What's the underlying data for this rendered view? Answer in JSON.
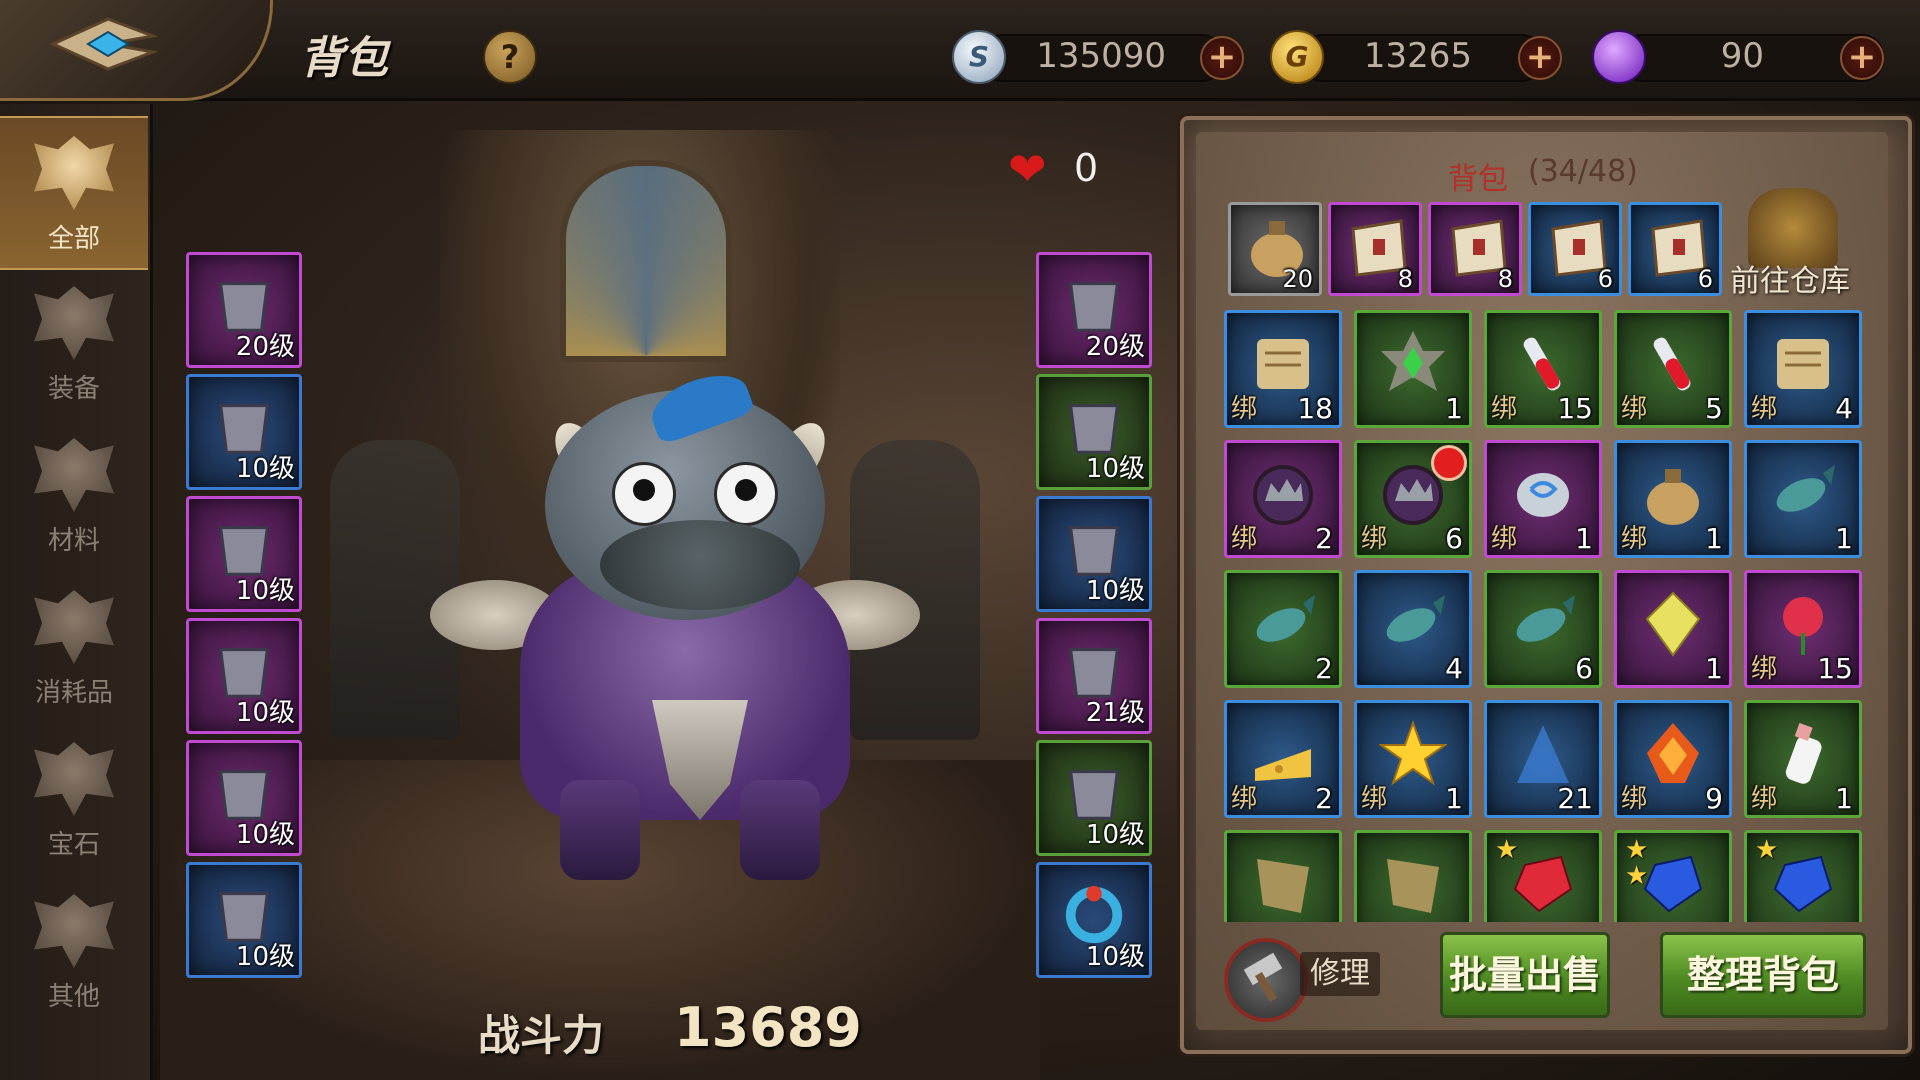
{
  "header": {
    "title": "背包",
    "help_icon": "?",
    "currencies": [
      {
        "name": "silver-coin-icon",
        "symbol": "S",
        "value": "135090",
        "color": "#c8d4e0"
      },
      {
        "name": "gold-coin-icon",
        "symbol": "G",
        "value": "13265",
        "color": "#e8b428"
      },
      {
        "name": "purple-gem-icon",
        "symbol": "",
        "value": "90",
        "color": "#9a48e0"
      }
    ],
    "plus": "+"
  },
  "tabs": [
    {
      "label": "全部",
      "active": true
    },
    {
      "label": "装备",
      "active": false
    },
    {
      "label": "材料",
      "active": false
    },
    {
      "label": "消耗品",
      "active": false
    },
    {
      "label": "宝石",
      "active": false
    },
    {
      "label": "其他",
      "active": false
    }
  ],
  "character": {
    "likes": "0",
    "power_label": "战斗力",
    "power_value": "13689"
  },
  "equipment_left": [
    {
      "level": "20级",
      "quality": "purple",
      "icon": "horn-weapon-icon"
    },
    {
      "level": "10级",
      "quality": "blue",
      "icon": "spiked-pauldron-icon"
    },
    {
      "level": "10级",
      "quality": "purple",
      "icon": "flame-horn-icon"
    },
    {
      "level": "10级",
      "quality": "purple",
      "icon": "belt-icon"
    },
    {
      "level": "10级",
      "quality": "purple",
      "icon": "armor-pants-icon"
    },
    {
      "level": "10级",
      "quality": "blue",
      "icon": "boots-icon"
    }
  ],
  "equipment_right": [
    {
      "level": "20级",
      "quality": "purple",
      "icon": "helmet-icon"
    },
    {
      "level": "10级",
      "quality": "green",
      "icon": "amulet-icon"
    },
    {
      "level": "10级",
      "quality": "blue",
      "icon": "chest-armor-icon"
    },
    {
      "level": "21级",
      "quality": "purple",
      "icon": "gold-bracer-icon"
    },
    {
      "level": "10级",
      "quality": "green",
      "icon": "gauntlet-icon"
    },
    {
      "level": "10级",
      "quality": "blue",
      "icon": "ring-icon"
    }
  ],
  "inventory": {
    "title": "背包",
    "count": "(34/48)",
    "bind_label": "绑",
    "top_row": [
      {
        "count": "20",
        "quality": "gray",
        "icon": "money-bag-icon"
      },
      {
        "count": "8",
        "quality": "purple",
        "icon": "bag-icon"
      },
      {
        "count": "8",
        "quality": "purple",
        "icon": "bag-icon"
      },
      {
        "count": "6",
        "quality": "blue",
        "icon": "bag-icon"
      },
      {
        "count": "6",
        "quality": "blue",
        "icon": "bag-icon"
      }
    ],
    "warehouse_label": "前往仓库",
    "rows": [
      [
        {
          "count": "18",
          "bound": true,
          "quality": "blue",
          "icon": "horn-scroll-icon"
        },
        {
          "count": "1",
          "bound": false,
          "quality": "green",
          "icon": "green-crystal-badge-icon"
        },
        {
          "count": "15",
          "bound": true,
          "quality": "green",
          "icon": "red-potion-icon"
        },
        {
          "count": "5",
          "bound": true,
          "quality": "green",
          "icon": "red-potion-icon"
        },
        {
          "count": "4",
          "bound": true,
          "quality": "blue",
          "icon": "scroll-icon"
        }
      ],
      [
        {
          "count": "2",
          "bound": true,
          "quality": "purple",
          "icon": "crown-orb-icon"
        },
        {
          "count": "6",
          "bound": true,
          "quality": "green",
          "icon": "crown-orb-icon",
          "dot": true
        },
        {
          "count": "1",
          "bound": true,
          "quality": "purple",
          "icon": "rune-stone-icon"
        },
        {
          "count": "1",
          "bound": true,
          "quality": "blue",
          "icon": "gem-pouch-icon"
        },
        {
          "count": "1",
          "bound": false,
          "quality": "blue",
          "icon": "purple-fish-icon"
        }
      ],
      [
        {
          "count": "2",
          "bound": false,
          "quality": "green",
          "icon": "fish-icon"
        },
        {
          "count": "4",
          "bound": false,
          "quality": "blue",
          "icon": "fish-icon"
        },
        {
          "count": "6",
          "bound": false,
          "quality": "green",
          "icon": "flatfish-icon"
        },
        {
          "count": "1",
          "bound": false,
          "quality": "purple",
          "icon": "yellow-crystal-icon"
        },
        {
          "count": "15",
          "bound": true,
          "quality": "purple",
          "icon": "red-flower-icon"
        }
      ],
      [
        {
          "count": "2",
          "bound": true,
          "quality": "blue",
          "icon": "cheese-icon"
        },
        {
          "count": "1",
          "bound": true,
          "quality": "blue",
          "icon": "gold-star-icon"
        },
        {
          "count": "21",
          "bound": false,
          "quality": "blue",
          "icon": "ice-shard-icon"
        },
        {
          "count": "9",
          "bound": true,
          "quality": "blue",
          "icon": "fire-crystal-icon"
        },
        {
          "count": "1",
          "bound": true,
          "quality": "green",
          "icon": "milk-bottle-icon"
        }
      ],
      [
        {
          "count": "",
          "bound": false,
          "quality": "green",
          "icon": "cloth-scrap-icon"
        },
        {
          "count": "",
          "bound": false,
          "quality": "green",
          "icon": "cloth-scrap-icon"
        },
        {
          "count": "",
          "bound": false,
          "quality": "green",
          "icon": "red-gem-icon",
          "stars": 1
        },
        {
          "count": "",
          "bound": false,
          "quality": "green",
          "icon": "blue-gem-icon",
          "stars": 2
        },
        {
          "count": "",
          "bound": false,
          "quality": "green",
          "icon": "blue-gem-icon",
          "stars": 1
        }
      ]
    ],
    "repair_label": "修理",
    "sell_label": "批量出售",
    "sort_label": "整理背包"
  },
  "colors": {
    "accent_gold": "#c59a52",
    "purple_quality": "#c24ad2",
    "blue_quality": "#3b8ee0",
    "green_quality": "#5aa83a",
    "button_green": "#6aa834"
  }
}
